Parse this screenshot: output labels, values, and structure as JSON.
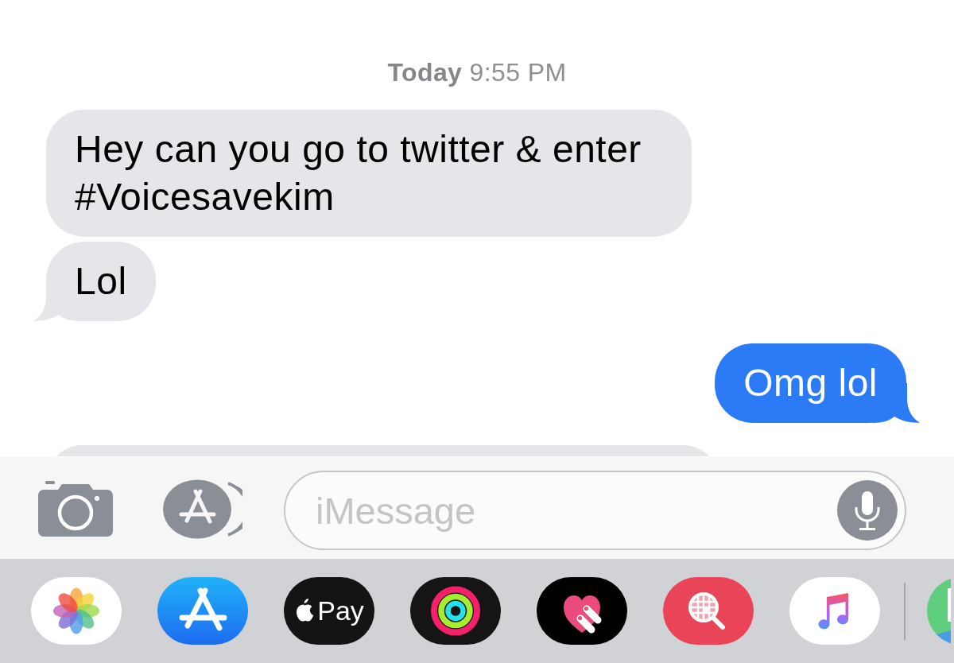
{
  "timestamp": "**Today** 9:55 PM",
  "messages": [
    {
      "kind": "received",
      "text": "Hey can you go to twitter & enter #Voicesavekim",
      "tail": false
    },
    {
      "kind": "received",
      "text": "Lol",
      "tail": true
    },
    {
      "kind": "sent",
      "text": "Omg lol",
      "tail": true
    },
    {
      "kind": "received"
    }
  ],
  "composer": {
    "placeholder": "iMessage"
  },
  "apps": [
    {
      "kind": "photos"
    },
    {
      "kind": "store"
    },
    {
      "kind": "pay",
      "label": "Pay"
    },
    {
      "kind": "activity"
    },
    {
      "kind": "heart"
    },
    {
      "kind": "search"
    },
    {
      "kind": "music"
    },
    {
      "kind": "separator"
    },
    {
      "kind": "partial"
    }
  ]
}
